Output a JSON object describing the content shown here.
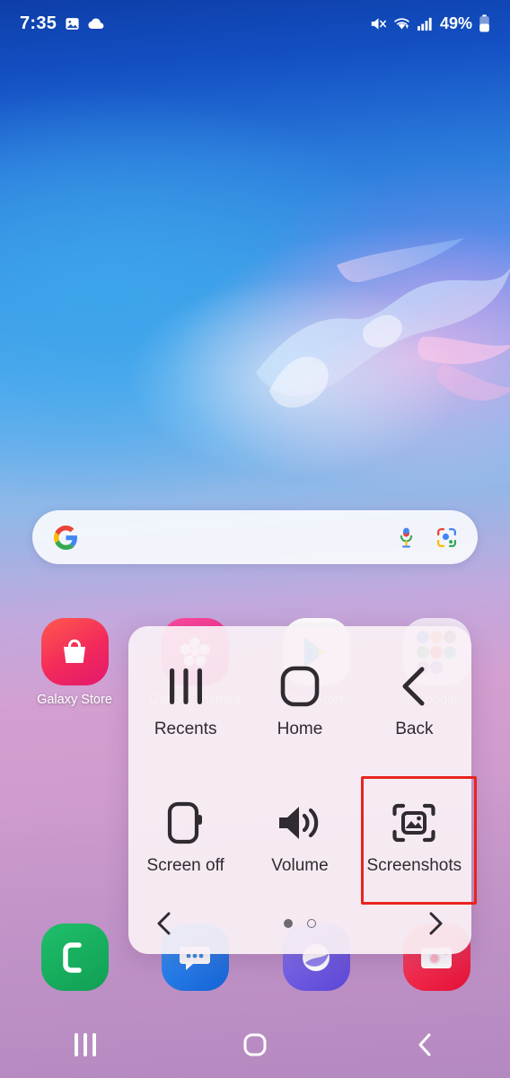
{
  "status_bar": {
    "time": "7:35",
    "battery_percent": "49%",
    "left_icons": [
      "gallery-image-icon",
      "cloud-sync-icon"
    ],
    "right_icons": [
      "mute-vibrate-icon",
      "wifi-icon",
      "cellular-signal-icon",
      "battery-icon"
    ]
  },
  "search": {
    "placeholder": "",
    "value": "",
    "google_logo": "google-g-icon",
    "mic_icon": "microphone-icon",
    "lens_icon": "google-lens-icon"
  },
  "home_apps": [
    {
      "label": "Galaxy Store",
      "icon": "galaxy-store-icon",
      "color": "#f2295b"
    },
    {
      "label": "Galaxy Themes",
      "icon": "galaxy-themes-icon",
      "color": "#e0157c"
    },
    {
      "label": "Play Store",
      "icon": "play-store-icon",
      "color": "#ffffff"
    },
    {
      "label": "Google",
      "icon": "google-folder-icon",
      "color": "#f3eef6"
    }
  ],
  "dock_apps": [
    {
      "label": "Phone",
      "icon": "phone-icon",
      "color": "#16a75c"
    },
    {
      "label": "Messages",
      "icon": "messages-icon",
      "color": "#1a73e8"
    },
    {
      "label": "Internet",
      "icon": "internet-browser-icon",
      "color": "#6b5ce7"
    },
    {
      "label": "Camera",
      "icon": "camera-icon",
      "color": "#e8183c"
    }
  ],
  "assistant_menu": {
    "highlight_color": "#e8241f",
    "highlighted_item": "Screenshots",
    "items": [
      {
        "label": "Recents",
        "icon": "recents-bars-icon",
        "highlighted": false
      },
      {
        "label": "Home",
        "icon": "home-square-icon",
        "highlighted": false
      },
      {
        "label": "Back",
        "icon": "back-chevron-icon",
        "highlighted": false
      },
      {
        "label": "Screen off",
        "icon": "screen-off-icon",
        "highlighted": false
      },
      {
        "label": "Volume",
        "icon": "volume-speaker-icon",
        "highlighted": false
      },
      {
        "label": "Screenshots",
        "icon": "screenshot-capture-icon",
        "highlighted": true
      }
    ],
    "pager": {
      "prev_icon": "chevron-left-icon",
      "next_icon": "chevron-right-icon",
      "page_count": 2,
      "current_page": 1
    }
  },
  "nav_bar": {
    "buttons": [
      {
        "label": "Recents",
        "icon": "nav-recents-icon"
      },
      {
        "label": "Home",
        "icon": "nav-home-icon"
      },
      {
        "label": "Back",
        "icon": "nav-back-icon"
      }
    ]
  }
}
